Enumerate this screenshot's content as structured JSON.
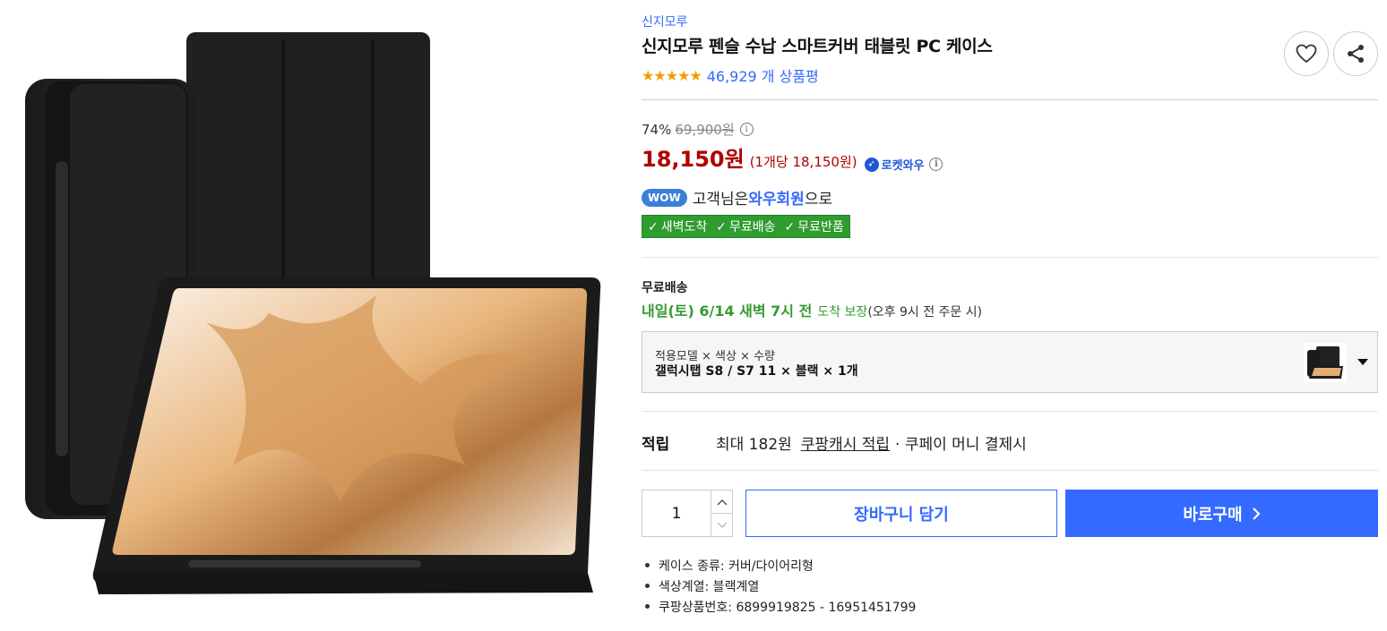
{
  "product": {
    "brand": "신지모루",
    "title": "신지모루 펜슬 수납 스마트커버 태블릿 PC 케이스",
    "rating_stars": "★★★★★",
    "review_count": "46,929 개 상품평"
  },
  "price": {
    "discount_rate": "74%",
    "original_price": "69,900원",
    "sale_price": "18,150원",
    "unit_price": "(1개당 18,150원)",
    "rocket_label": "로켓와우"
  },
  "membership": {
    "wow_badge": "WOW",
    "text_before": "고객님은",
    "highlight": "와우회원",
    "text_after": "으로",
    "benefits": [
      "새벽도착",
      "무료배송",
      "무료반품"
    ]
  },
  "shipping": {
    "label": "무료배송",
    "date": "내일(토) 6/14 새벽 7시 전",
    "guarantee": "도착 보장",
    "note": "(오후 9시 전 주문 시)"
  },
  "option": {
    "label": "적용모델 × 색상 × 수량",
    "value": "갤럭시탭 S8 / S7 11 × 블랙 × 1개"
  },
  "points": {
    "label": "적립",
    "text": "최대 182원",
    "link": "쿠팡캐시 적립",
    "extra": "· 쿠페이 머니 결제시"
  },
  "purchase": {
    "quantity": "1",
    "cart_label": "장바구니 담기",
    "buy_label": "바로구매"
  },
  "attributes": [
    "케이스 종류: 커버/다이어리형",
    "색상계열: 블랙계열",
    "쿠팡상품번호: 6899919825 - 16951451799"
  ],
  "colors": {
    "accent_blue": "#346aff",
    "price_red": "#ae0000",
    "shipping_green": "#339b33",
    "star_orange": "#f39c00"
  }
}
